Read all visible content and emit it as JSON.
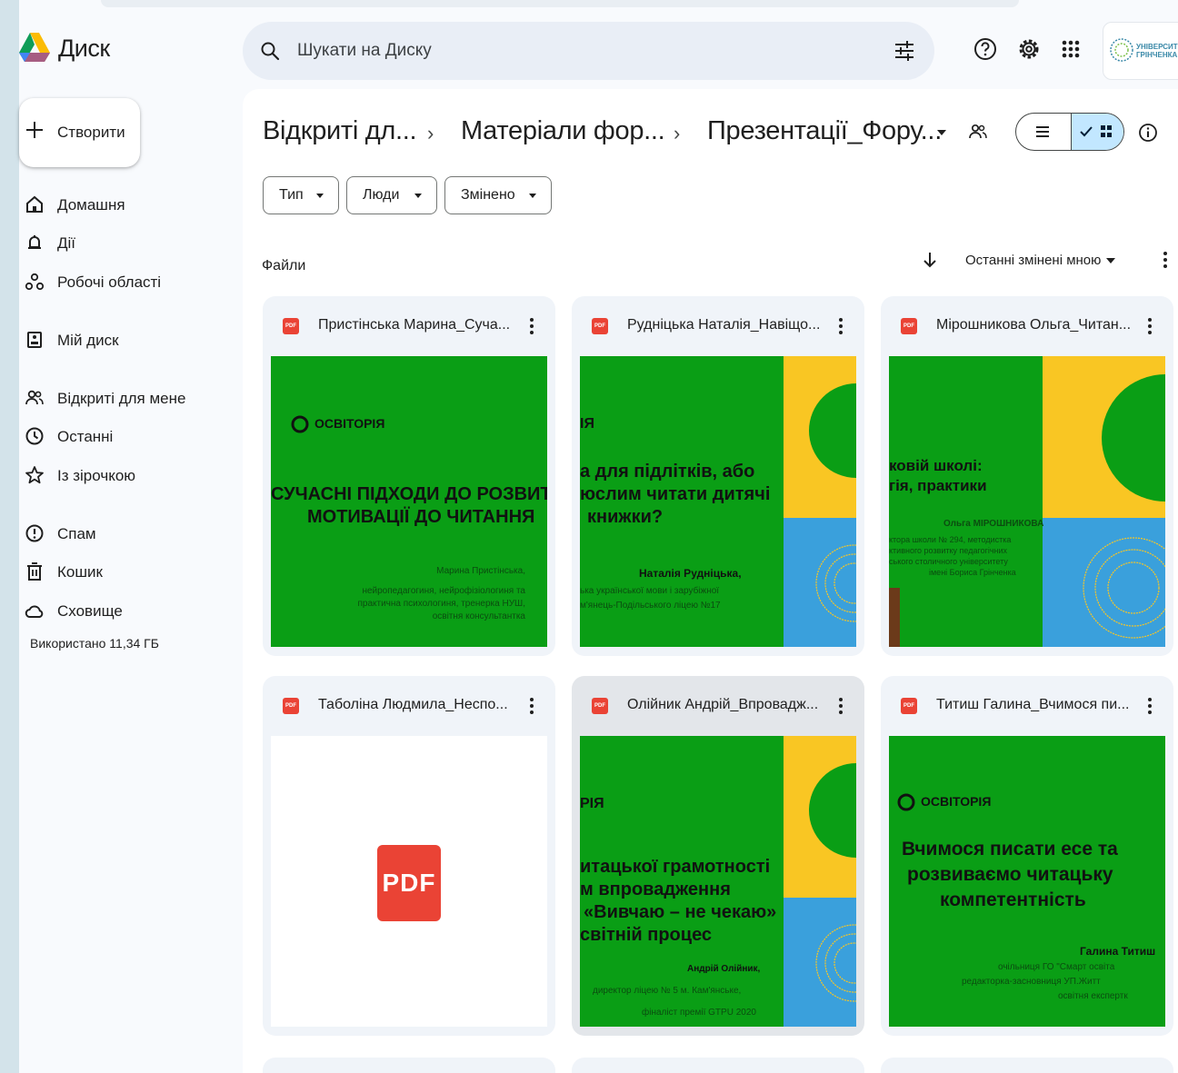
{
  "app": {
    "name": "Диск"
  },
  "search": {
    "placeholder": "Шукати на Диску"
  },
  "org": {
    "line1": "УНІВЕРСИТ",
    "line2": "ГРІНЧЕНКА"
  },
  "sidebar": {
    "new_label": "Створити",
    "items": [
      {
        "label": "Домашня",
        "icon": "home-icon"
      },
      {
        "label": "Дії",
        "icon": "bell-icon"
      },
      {
        "label": "Робочі області",
        "icon": "workspaces-icon"
      },
      {
        "label": "Мій диск",
        "icon": "my-drive-icon"
      },
      {
        "label": "Відкриті для мене",
        "icon": "shared-icon"
      },
      {
        "label": "Останні",
        "icon": "clock-icon"
      },
      {
        "label": "Із зірочкою",
        "icon": "star-icon"
      },
      {
        "label": "Спам",
        "icon": "spam-icon"
      },
      {
        "label": "Кошик",
        "icon": "trash-icon"
      },
      {
        "label": "Сховище",
        "icon": "cloud-icon"
      }
    ],
    "storage_text": "Використано 11,34 ГБ"
  },
  "breadcrumb": [
    "Відкриті дл...",
    "Матеріали фор...",
    "Презентації_Фору..."
  ],
  "filters": [
    "Тип",
    "Люди",
    "Змінено"
  ],
  "files": {
    "section_title": "Файли",
    "sort_label": "Останні змінені мною",
    "cards": [
      {
        "title": "Пристінська Марина_Суча...",
        "logo": "ОСВІТОРІЯ",
        "heading": [
          "СУЧАСНІ ПІДХОДИ ДО РОЗВИТК",
          "МОТИВАЦІЇ ДО ЧИТАННЯ"
        ],
        "author_lines": [
          "Марина Пристінська,",
          "нейропедагогиня, нейрофізіологиня та",
          "практична психологиня, тренерка НУШ,",
          "освітня консультантка"
        ]
      },
      {
        "title": "Рудніцька Наталія_Навіщо...",
        "logo": "ІЯ",
        "heading": [
          "а для підлітків, або",
          "юслим читати дитячі",
          "книжки?"
        ],
        "author": "Наталія Рудніцька,",
        "author_lines": [
          "ька української мови і зарубіжної",
          "м'янець-Подільського ліцею №17"
        ]
      },
      {
        "title": "Мірошникова Ольга_Читан...",
        "heading": [
          "ковій школі:",
          "гія, практики"
        ],
        "author": "Ольга МІРОШНИКОВА",
        "author_lines": [
          "ктора школи № 294, методистка",
          "ктивного розвитку педагогічних",
          "ського столичного університету",
          "імені Бориса Грінченка"
        ]
      },
      {
        "title": "Таболіна Людмила_Неспо...",
        "badge": "PDF"
      },
      {
        "title": "Олійник Андрій_Впровадж...",
        "logo": "РІЯ",
        "heading": [
          "итацької грамотності",
          "м впровадження",
          "«Вивчаю – не чекаю»",
          "світній процес"
        ],
        "author": "Андрій Олійник,",
        "author_lines": [
          "директор ліцею № 5 м. Кам'янське,",
          "фіналіст премії GTPU 2020"
        ]
      },
      {
        "title": "Титиш Галина_Вчимося пи...",
        "logo": "ОСВІТОРІЯ",
        "heading": [
          "Вчимося писати есе та",
          "розвиваємо читацьку",
          "компетентність"
        ],
        "author": "Галина Титиш",
        "author_lines": [
          "очільниця ГО \"Смарт освіта",
          "редакторка-засновниця УП.Житт",
          "освітня експертк"
        ]
      }
    ]
  },
  "colors": {
    "slide_green": "#0a9e15",
    "slide_yellow": "#f9c623",
    "slide_blue": "#3aa0dc",
    "accent": "#c2e7ff",
    "pdf_red": "#ea4335"
  }
}
